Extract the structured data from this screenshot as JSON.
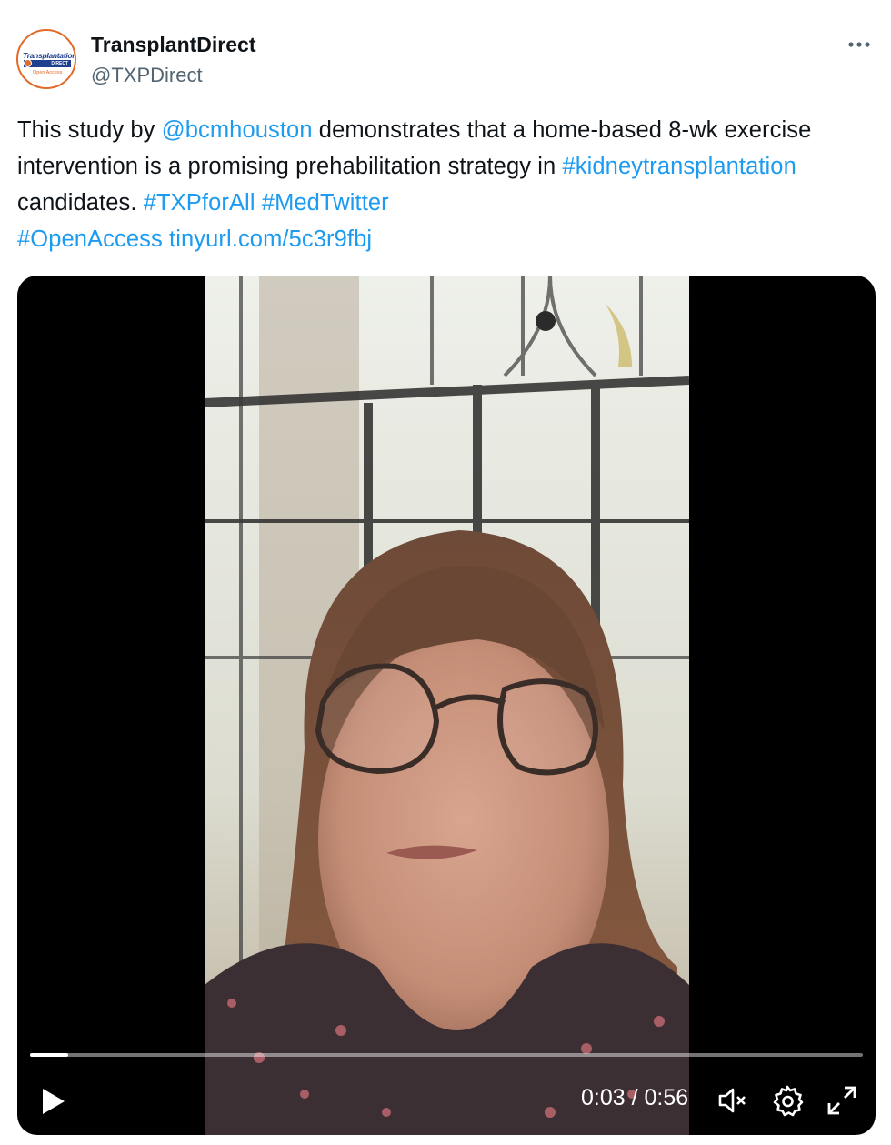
{
  "author": {
    "name": "TransplantDirect",
    "handle": "@TXPDirect",
    "avatar_text": "Transplantation",
    "avatar_bar_text": "DIRECT",
    "avatar_sub_text": "Open Access"
  },
  "more_icon": "more-horizontal-icon",
  "tweet": {
    "part1": "This study by ",
    "mention": "@bcmhouston",
    "part2": " demonstrates that a home-based 8-wk exercise intervention is a promising prehabilitation strategy in ",
    "hashtag1": "#kidneytransplantation",
    "part3": " candidates. ",
    "hashtag2": "#TXPforAll",
    "sep1": " ",
    "hashtag3": "#MedTwitter",
    "sep2": " ",
    "hashtag4": "#OpenAccess",
    "sep3": " ",
    "url": "tinyurl.com/5c3r9fbj"
  },
  "video": {
    "current_time": "0:03",
    "separator": " / ",
    "duration": "0:56",
    "progress_fraction": 0.046
  },
  "colors": {
    "link": "#1d9bf0",
    "text": "#0f1419",
    "secondary": "#536471",
    "avatar_border": "#e06b2a"
  },
  "icons": {
    "play": "play-icon",
    "mute": "volume-muted-icon",
    "settings": "gear-icon",
    "fullscreen": "fullscreen-icon"
  }
}
